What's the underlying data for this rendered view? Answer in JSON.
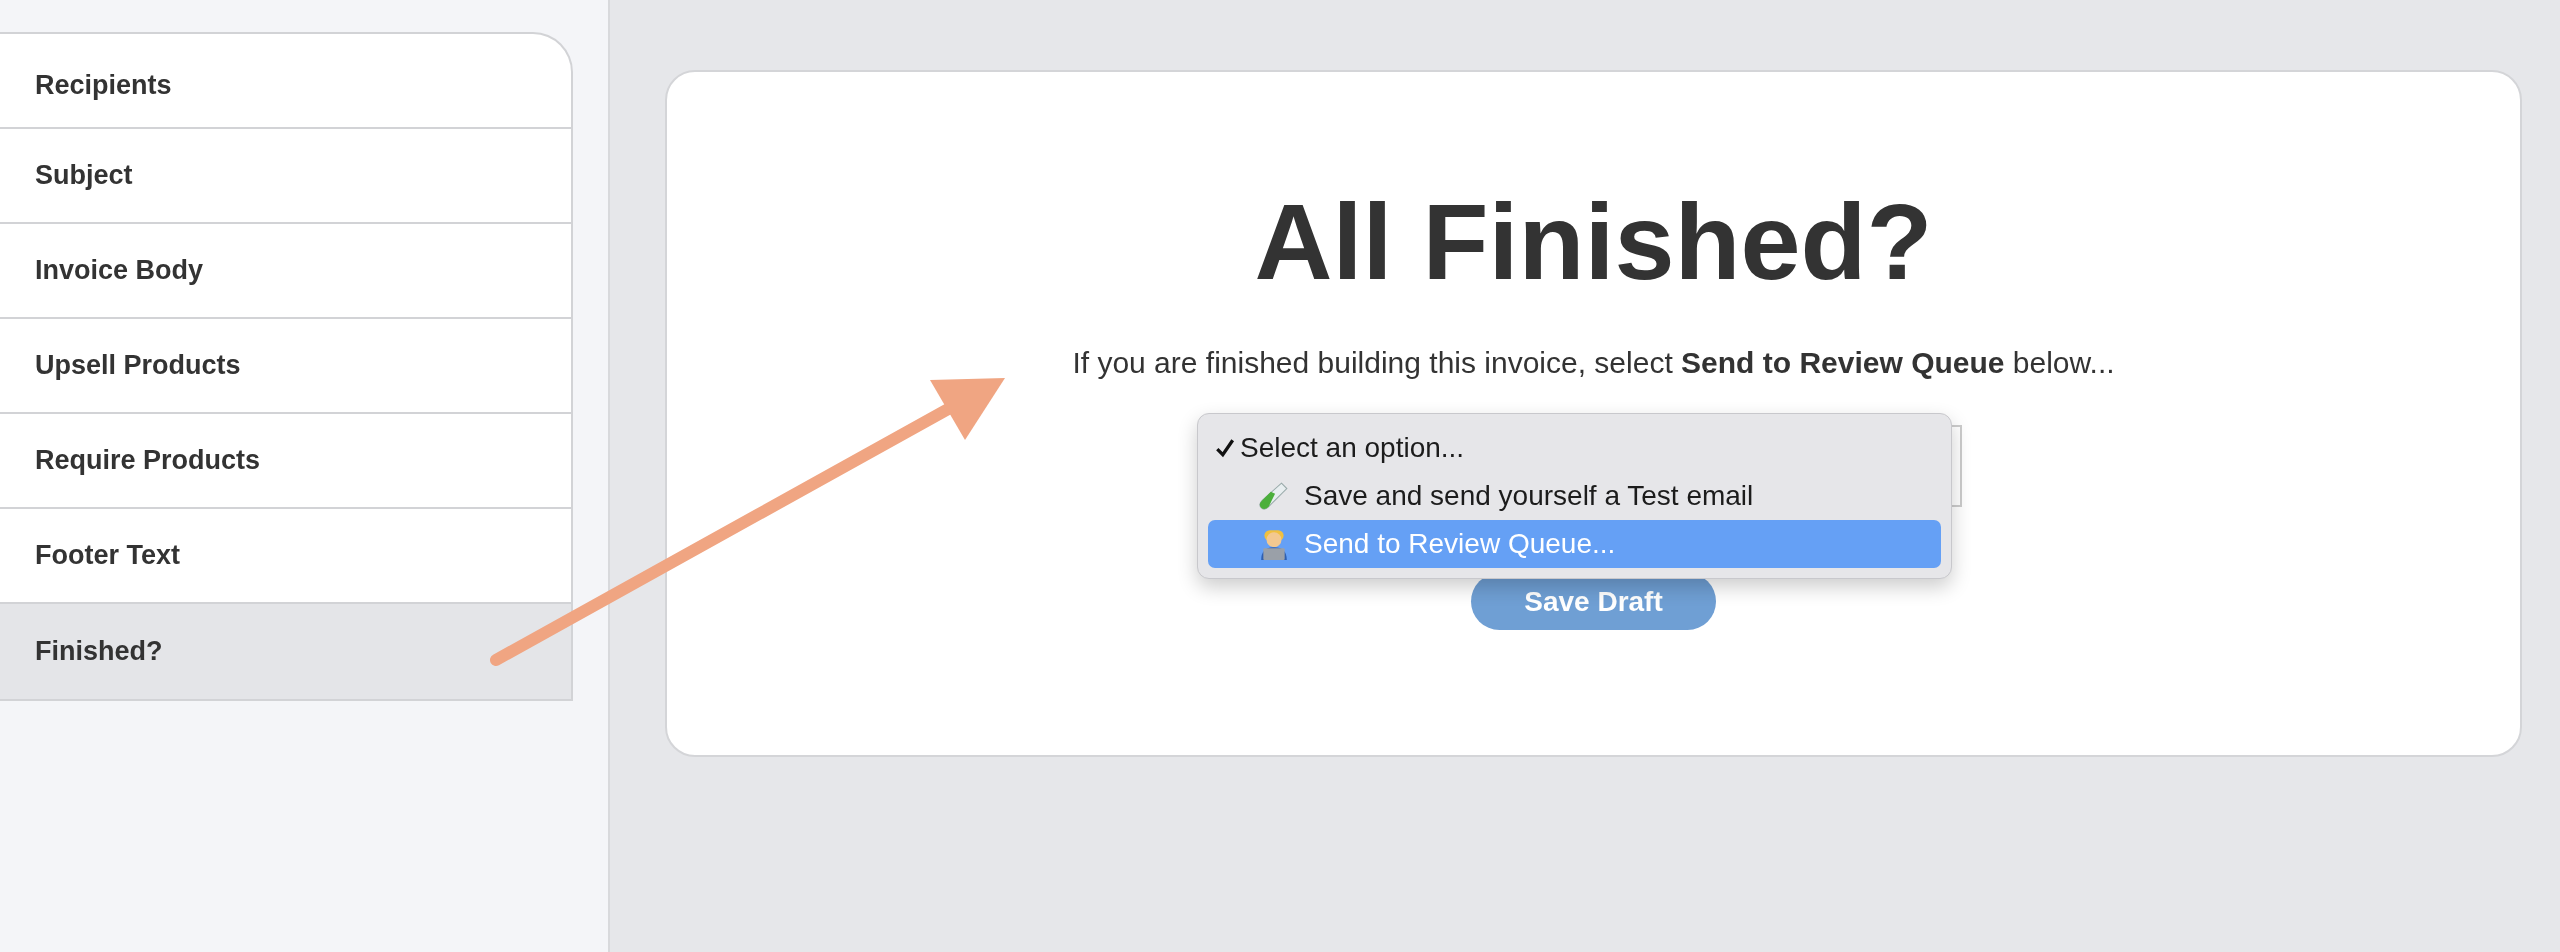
{
  "sidebar": {
    "items": [
      {
        "label": "Recipients",
        "selected": false
      },
      {
        "label": "Subject",
        "selected": false
      },
      {
        "label": "Invoice Body",
        "selected": false
      },
      {
        "label": "Upsell Products",
        "selected": false
      },
      {
        "label": "Require Products",
        "selected": false
      },
      {
        "label": "Footer Text",
        "selected": false
      },
      {
        "label": "Finished?",
        "selected": true
      }
    ]
  },
  "card": {
    "heading": "All Finished?",
    "text": "If you are finished building this invoice, select **Send to Review Queue** below...",
    "dropdown": {
      "options": [
        {
          "label": "Select an option...",
          "kind": "plain",
          "checked": true,
          "selected": false
        },
        {
          "label": "Save and send yourself a Test email",
          "kind": "test-tube",
          "checked": false,
          "selected": false
        },
        {
          "label": "Send to Review Queue...",
          "kind": "person-laptop",
          "checked": false,
          "selected": true
        }
      ]
    },
    "button": "Save Draft"
  },
  "annotation": {
    "kind": "arrow"
  }
}
